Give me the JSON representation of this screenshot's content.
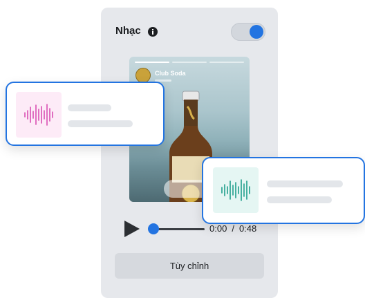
{
  "music": {
    "title": "Nhạc",
    "toggle_on": true
  },
  "media": {
    "account_name": "Club Soda",
    "progress_segments": 3
  },
  "player": {
    "current_time": "0:00",
    "separator": "/",
    "duration": "0:48"
  },
  "actions": {
    "customize_label": "Tùy chỉnh"
  },
  "tracks": [
    {
      "thumb_color": "#fdebf7",
      "wave_color": "#d94fb3",
      "icon": "audio-waveform-icon"
    },
    {
      "thumb_color": "#e5f6f3",
      "wave_color": "#1f9e8c",
      "icon": "audio-waveform-icon"
    }
  ],
  "colors": {
    "accent": "#2374e1",
    "panel": "#e6e8ec"
  }
}
